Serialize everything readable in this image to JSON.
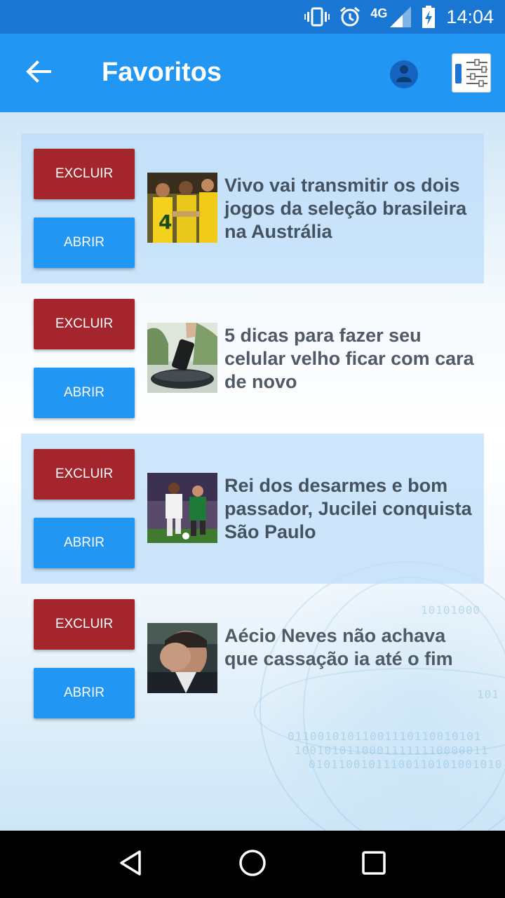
{
  "status_bar": {
    "network": "4G",
    "time": "14:04"
  },
  "app_bar": {
    "title": "Favoritos"
  },
  "favorites": [
    {
      "delete_label": "EXCLUIR",
      "open_label": "ABRIR",
      "headline": "Vivo vai transmitir os dois jogos da seleção brasileira na Austrália",
      "highlighted": true
    },
    {
      "delete_label": "EXCLUIR",
      "open_label": "ABRIR",
      "headline": "5 dicas para fazer seu celular velho ficar com cara de novo",
      "highlighted": false
    },
    {
      "delete_label": "EXCLUIR",
      "open_label": "ABRIR",
      "headline": "Rei dos desarmes e bom passador, Jucilei conquista São Paulo",
      "highlighted": true
    },
    {
      "delete_label": "EXCLUIR",
      "open_label": "ABRIR",
      "headline": "Aécio Neves não achava que cassação ia até o fim",
      "highlighted": false
    }
  ],
  "icons": {
    "back": "arrow-left-icon",
    "user": "user-icon",
    "settings": "settings-sliders-icon",
    "vibrate": "vibrate-icon",
    "alarm": "alarm-icon",
    "signal": "signal-icon",
    "battery": "battery-charging-icon",
    "nav_back": "nav-back-icon",
    "nav_home": "nav-home-icon",
    "nav_recents": "nav-recents-icon"
  },
  "colors": {
    "status_bar": "#1976d2",
    "app_bar": "#2196f3",
    "delete_button": "#a4262c",
    "open_button": "#2196f3",
    "highlight": "#bedefa"
  }
}
